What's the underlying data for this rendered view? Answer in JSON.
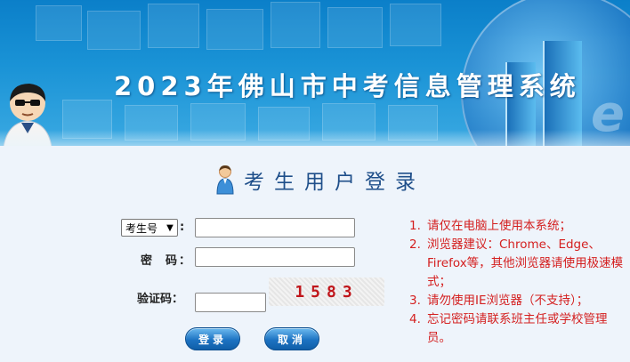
{
  "header": {
    "title": "2023年佛山市中考信息管理系统"
  },
  "login": {
    "heading": "考生用户登录",
    "id_type_select": {
      "selected": "考生号",
      "suffix": ":"
    },
    "id_input": {
      "value": "",
      "placeholder": ""
    },
    "password_label": "密  码：",
    "password_input": {
      "value": "",
      "placeholder": ""
    },
    "captcha_label": "验证码：",
    "captcha_input": {
      "value": "",
      "placeholder": ""
    },
    "captcha_code": "1583",
    "login_button": "登录",
    "cancel_button": "取消"
  },
  "notices": [
    {
      "num": "1.",
      "text": "请仅在电脑上使用本系统；"
    },
    {
      "num": "2.",
      "text": "浏览器建议：Chrome、Edge、Firefox等，其他浏览器请使用极速模式；"
    },
    {
      "num": "3.",
      "text": "请勿使用IE浏览器（不支持）；"
    },
    {
      "num": "4.",
      "text": "忘记密码请联系班主任或学校管理员。"
    }
  ],
  "colors": {
    "banner_blue": "#1a93d6",
    "heading_blue": "#1f4f8a",
    "notice_red": "#d41f1f",
    "captcha_red": "#c0161b",
    "page_bg": "#eef4fb"
  }
}
